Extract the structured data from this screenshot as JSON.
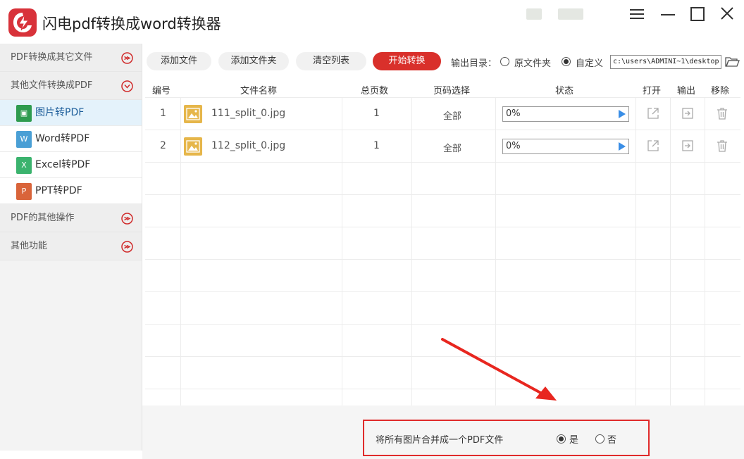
{
  "app": {
    "title": "闪电pdf转换成word转换器",
    "logo_icon": "lightning-logo-icon",
    "window_controls": [
      "menu-icon",
      "minimize-icon",
      "maximize-icon",
      "close-icon"
    ]
  },
  "sidebar": {
    "categories": [
      {
        "label": "PDF转换成其它文件",
        "icon": "collapsed-arrow-icon"
      },
      {
        "label": "其他文件转换成PDF",
        "icon": "expanded-arrow-icon"
      },
      {
        "label": "PDF的其他操作",
        "icon": "collapsed-arrow-icon"
      },
      {
        "label": "其他功能",
        "icon": "collapsed-arrow-icon"
      }
    ],
    "items": [
      {
        "label": "图片转PDF",
        "badge": "▣",
        "color": "#2e9b4f",
        "active": true
      },
      {
        "label": "Word转PDF",
        "badge": "W",
        "color": "#4a9fd5",
        "active": false
      },
      {
        "label": "Excel转PDF",
        "badge": "X",
        "color": "#3bb36e",
        "active": false
      },
      {
        "label": "PPT转PDF",
        "badge": "P",
        "color": "#d9643a",
        "active": false
      }
    ]
  },
  "toolbar": {
    "add_file": "添加文件",
    "add_folder": "添加文件夹",
    "clear_list": "清空列表",
    "start_convert": "开始转换",
    "output_label": "输出目录：",
    "option_original": "原文件夹",
    "option_custom": "自定义",
    "selected_option": "custom",
    "path_value": "c:\\users\\ADMINI~1\\desktop",
    "primary_color": "#d9302b"
  },
  "table": {
    "headers": [
      "编号",
      "文件名称",
      "总页数",
      "页码选择",
      "状态",
      "打开",
      "输出",
      "移除"
    ],
    "rows": [
      {
        "index": "1",
        "filename": "111_split_0.jpg",
        "pages": "1",
        "page_select": "全部",
        "status": "0%"
      },
      {
        "index": "2",
        "filename": "112_split_0.jpg",
        "pages": "1",
        "page_select": "全部",
        "status": "0%"
      }
    ]
  },
  "merge": {
    "label": "将所有图片合并成一个PDF文件",
    "yes": "是",
    "no": "否",
    "selected": "yes",
    "highlight_color": "#e02b2b"
  }
}
